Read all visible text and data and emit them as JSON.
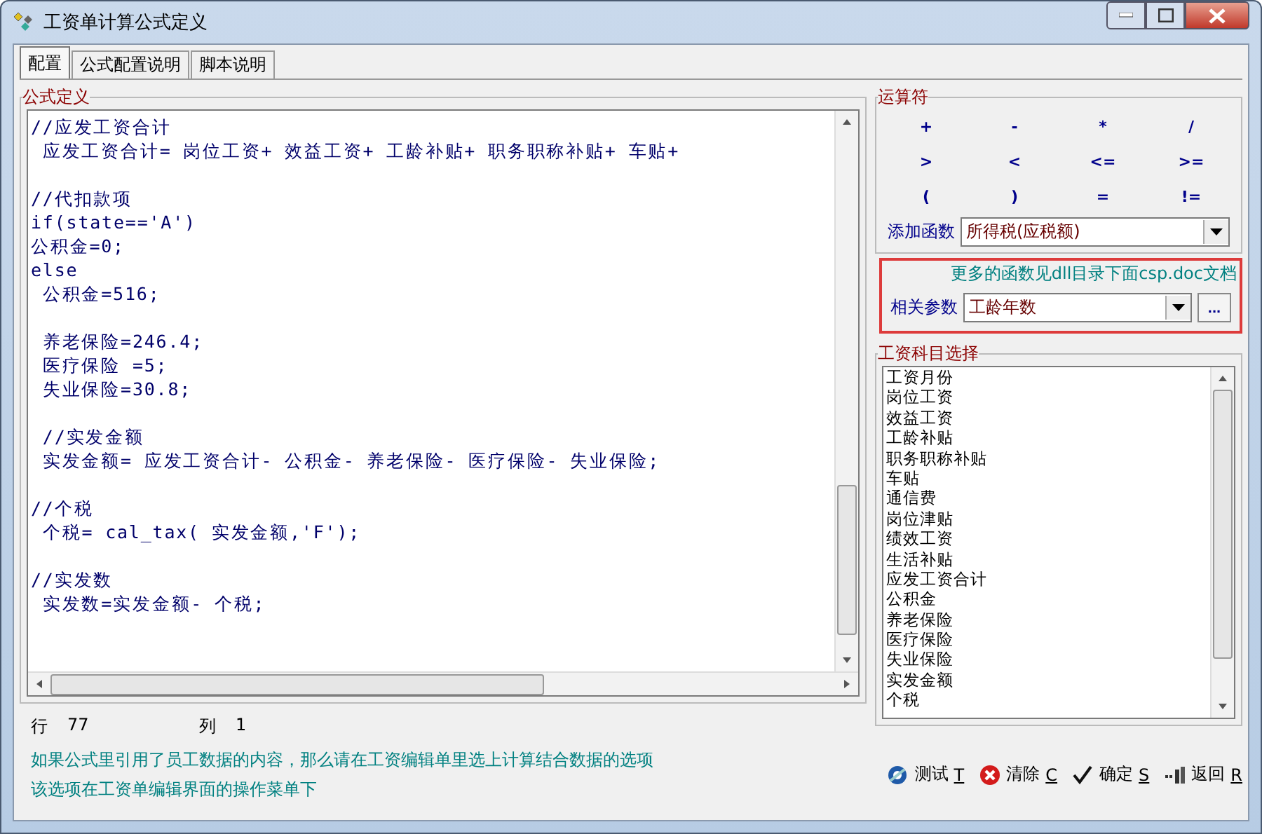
{
  "window": {
    "title": "工资单计算公式定义"
  },
  "tabs": [
    {
      "label": "配置",
      "selected": true
    },
    {
      "label": "公式配置说明",
      "selected": false
    },
    {
      "label": "脚本说明",
      "selected": false
    }
  ],
  "formula": {
    "title": "公式定义",
    "blocks": [
      [
        "//应发工资合计",
        " 应发工资合计= 岗位工资+ 效益工资+ 工龄补贴+ 职务职称补贴+ 车贴+"
      ],
      [
        "//代扣款项",
        "if(state=='A')",
        "公积金=0;",
        "else",
        " 公积金=516;"
      ],
      [
        " 养老保险=246.4;",
        " 医疗保险 =5;",
        " 失业保险=30.8;"
      ],
      [
        " //实发金额",
        " 实发金额= 应发工资合计- 公积金- 养老保险- 医疗保险- 失业保险;"
      ],
      [
        "//个税",
        " 个税= cal_tax( 实发金额,'F');"
      ],
      [
        "//实发数",
        " 实发数=实发金额- 个税;"
      ]
    ]
  },
  "position": {
    "row_label": "行",
    "row": "77",
    "col_label": "列",
    "col": "1"
  },
  "notes": [
    "如果公式里引用了员工数据的内容，那么请在工资编辑单里选上计算结合数据的选项",
    "该选项在工资单编辑界面的操作菜单下"
  ],
  "operators": {
    "title": "运算符",
    "items": [
      "+",
      "-",
      "*",
      "/",
      ">",
      "<",
      "<=",
      ">=",
      "(",
      ")",
      "=",
      "!="
    ]
  },
  "function": {
    "label": "添加函数",
    "value": "所得税(应税额)"
  },
  "hint": "更多的函数见dll目录下面csp.doc文档",
  "param": {
    "label": "相关参数",
    "value": "工龄年数",
    "more": "..."
  },
  "items": {
    "title": "工资科目选择",
    "list": [
      "工资月份",
      "岗位工资",
      "效益工资",
      "工龄补贴",
      "职务职称补贴",
      "车贴",
      "通信费",
      "岗位津贴",
      "绩效工资",
      "生活补贴",
      "应发工资合计",
      "公积金",
      "养老保险",
      "医疗保险",
      "失业保险",
      "实发金额",
      "个税"
    ]
  },
  "buttons": [
    {
      "kind": "test",
      "label": "测试",
      "key": "T"
    },
    {
      "kind": "clear",
      "label": "清除",
      "key": "C"
    },
    {
      "kind": "ok",
      "label": "确定",
      "key": "S"
    },
    {
      "kind": "back",
      "label": "返回",
      "key": "R"
    }
  ]
}
